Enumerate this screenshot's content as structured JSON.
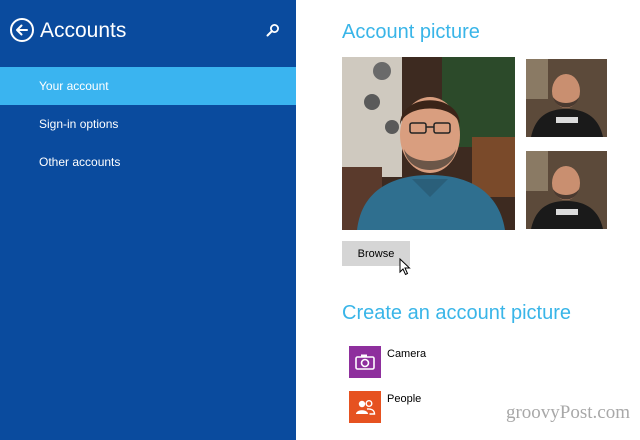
{
  "sidebar": {
    "title": "Accounts",
    "back_icon": "back-arrow-icon",
    "search_icon": "search-icon",
    "background_color": "#0a4b9e",
    "selected_color": "#3ab4f0",
    "items": [
      {
        "label": "Your account",
        "selected": true
      },
      {
        "label": "Sign-in options",
        "selected": false
      },
      {
        "label": "Other accounts",
        "selected": false
      }
    ]
  },
  "main": {
    "account_picture_title": "Account picture",
    "browse_label": "Browse",
    "create_title": "Create an account picture",
    "accent_color": "#39b5e8",
    "apps": [
      {
        "label": "Camera",
        "icon": "camera-icon",
        "color": "#8e2f9d"
      },
      {
        "label": "People",
        "icon": "people-icon",
        "color": "#e65220"
      }
    ]
  },
  "watermark": "groovyPost.com"
}
